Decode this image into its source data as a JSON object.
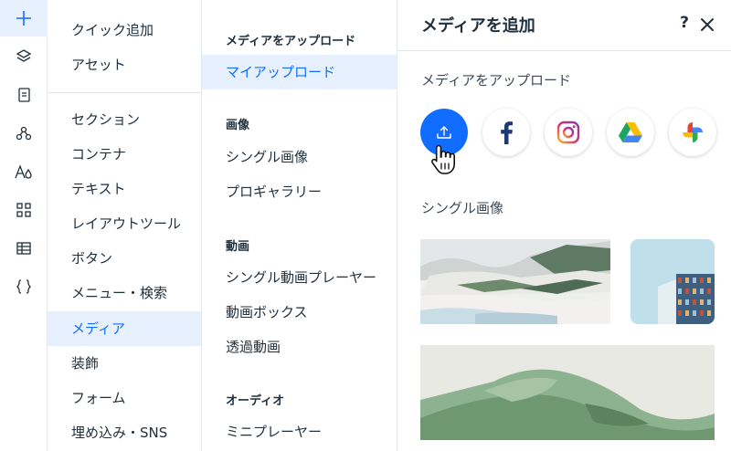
{
  "rail": {
    "icons": [
      "add-icon",
      "layers-icon",
      "page-icon",
      "components-icon",
      "design-icon",
      "apps-icon",
      "table-icon",
      "code-icon"
    ],
    "accent": "#116dff"
  },
  "categories": {
    "items": [
      "クイック追加",
      "アセット",
      "セクション",
      "コンテナ",
      "テキスト",
      "レイアウトツール",
      "ボタン",
      "メニュー・検索",
      "メディア",
      "装飾",
      "フォーム",
      "埋め込み・SNS"
    ],
    "selected": "メディア"
  },
  "subcategories": {
    "media_header": "メディアをアップロード",
    "my_uploads": "マイアップロード",
    "images_header": "画像",
    "single_image": "シングル画像",
    "pro_gallery": "プロギャラリー",
    "video_header": "動画",
    "single_video_player": "シングル動画プレーヤー",
    "video_box": "動画ボックス",
    "transparent_video": "透過動画",
    "audio_header": "オーディオ",
    "mini_player": "ミニプレーヤー"
  },
  "panel": {
    "title": "メディアを追加",
    "help": "?",
    "upload_section_label": "メディアをアップロード",
    "sources": [
      "upload-icon",
      "facebook-icon",
      "instagram-icon",
      "google-drive-icon",
      "google-photos-icon"
    ],
    "single_image_label": "シングル画像"
  },
  "colors": {
    "accent": "#116dff",
    "selected_bg": "#e7f0ff",
    "text": "#20303c",
    "divider": "#e5e8eb"
  }
}
